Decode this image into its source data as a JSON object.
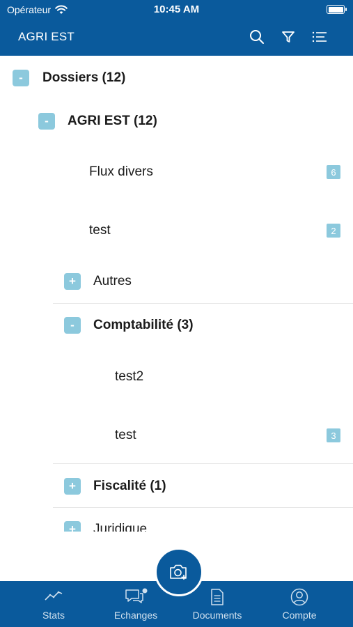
{
  "status": {
    "carrier": "Opérateur",
    "time": "10:45 AM"
  },
  "app_bar": {
    "title": "AGRI EST"
  },
  "tree": {
    "root": {
      "label": "Dossiers (12)",
      "toggle": "-"
    },
    "agri": {
      "label": "AGRI EST (12)",
      "toggle": "-"
    },
    "flux": {
      "label": "Flux divers",
      "badge": "6"
    },
    "test": {
      "label": "test",
      "badge": "2"
    },
    "autres": {
      "label": "Autres",
      "toggle": "+"
    },
    "compta": {
      "label": "Comptabilité (3)",
      "toggle": "-"
    },
    "compta_test2": {
      "label": "test2"
    },
    "compta_test": {
      "label": "test",
      "badge": "3"
    },
    "fiscalite": {
      "label": "Fiscalité (1)",
      "toggle": "+"
    },
    "juridique": {
      "label": "Juridique",
      "toggle": "+"
    }
  },
  "tabs": {
    "stats": "Stats",
    "echanges": "Echanges",
    "documents": "Documents",
    "compte": "Compte"
  },
  "colors": {
    "primary": "#0a5a9c",
    "accent": "#8cc9dd"
  },
  "icons": [
    "wifi-icon",
    "battery-icon",
    "search-icon",
    "filter-icon",
    "list-icon",
    "camera-add-icon",
    "chart-icon",
    "chat-icon",
    "document-icon",
    "account-icon"
  ]
}
